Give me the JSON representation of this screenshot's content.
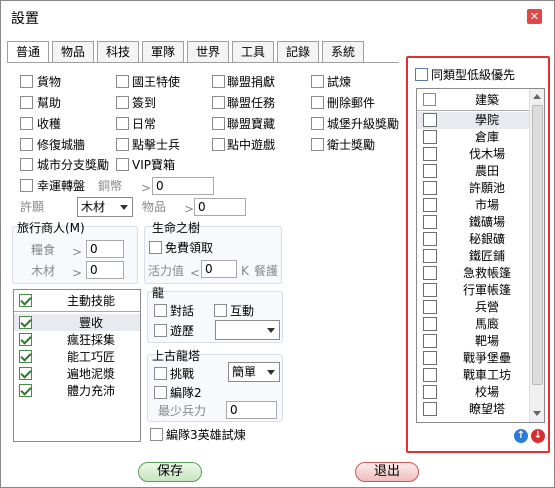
{
  "window": {
    "title": "設置"
  },
  "tabs": [
    "普通",
    "物品",
    "科技",
    "軍隊",
    "世界",
    "工具",
    "記錄",
    "系統"
  ],
  "options": {
    "col1": [
      "貨物",
      "幫助",
      "收穫",
      "修復城牆",
      "城市分支獎勵",
      "幸運轉盤"
    ],
    "col2": [
      "國王特使",
      "簽到",
      "日常",
      "點擊士兵",
      "VIP寶箱"
    ],
    "col3": [
      "聯盟捐獻",
      "聯盟任務",
      "聯盟寶藏",
      "點中遊戲"
    ],
    "col4": [
      "試煉",
      "刪除郵件",
      "城堡升級獎勵",
      "衛士獎勵"
    ],
    "coin_label": "銅幣",
    "coin_gt": ">",
    "coin_value": "0"
  },
  "wish": {
    "label": "許願",
    "select_value": "木材",
    "item_label": "物品",
    "item_gt": ">",
    "item_value": "0"
  },
  "merchant": {
    "title": "旅行商人(M)",
    "food_label": "糧食",
    "food_gt": ">",
    "food_value": "0",
    "wood_label": "木材",
    "wood_gt": ">",
    "wood_value": "0"
  },
  "tree": {
    "title": "生命之樹",
    "free_label": "免費領取",
    "vitality_label": "活力值",
    "vitality_lt": "<",
    "vitality_value": "0",
    "k_label": "K",
    "feed_label": "餐護"
  },
  "skills": {
    "header": "主動技能",
    "items": [
      "豐收",
      "瘋狂採集",
      "能工巧匠",
      "遍地泥漿",
      "體力充沛"
    ]
  },
  "dragon": {
    "title": "龍",
    "dialog_label": "對話",
    "interact_label": "互動",
    "play_label": "遊歷"
  },
  "ancient": {
    "title": "上古龍塔",
    "challenge_label": "挑戰",
    "difficulty": "簡單",
    "team2_label": "編隊2",
    "min_troops_label": "最少兵力",
    "min_troops_value": "0"
  },
  "hero_trial": {
    "label": "編隊3英雄試煉"
  },
  "priority": {
    "label": "同類型低級優先"
  },
  "buildings": {
    "header": "建築",
    "items": [
      "學院",
      "倉庫",
      "伐木場",
      "農田",
      "許願池",
      "市場",
      "鐵礦場",
      "秘銀礦",
      "鐵匠鋪",
      "急救帳篷",
      "行軍帳篷",
      "兵營",
      "馬廄",
      "靶場",
      "戰爭堡壘",
      "戰車工坊",
      "校場",
      "瞭望塔"
    ]
  },
  "footer": {
    "save_label": "保存",
    "exit_label": "退出"
  },
  "colors": {
    "highlight_border": "#e03030",
    "save_bg": "#c6e6bd",
    "exit_bg": "#f0bcbc"
  }
}
